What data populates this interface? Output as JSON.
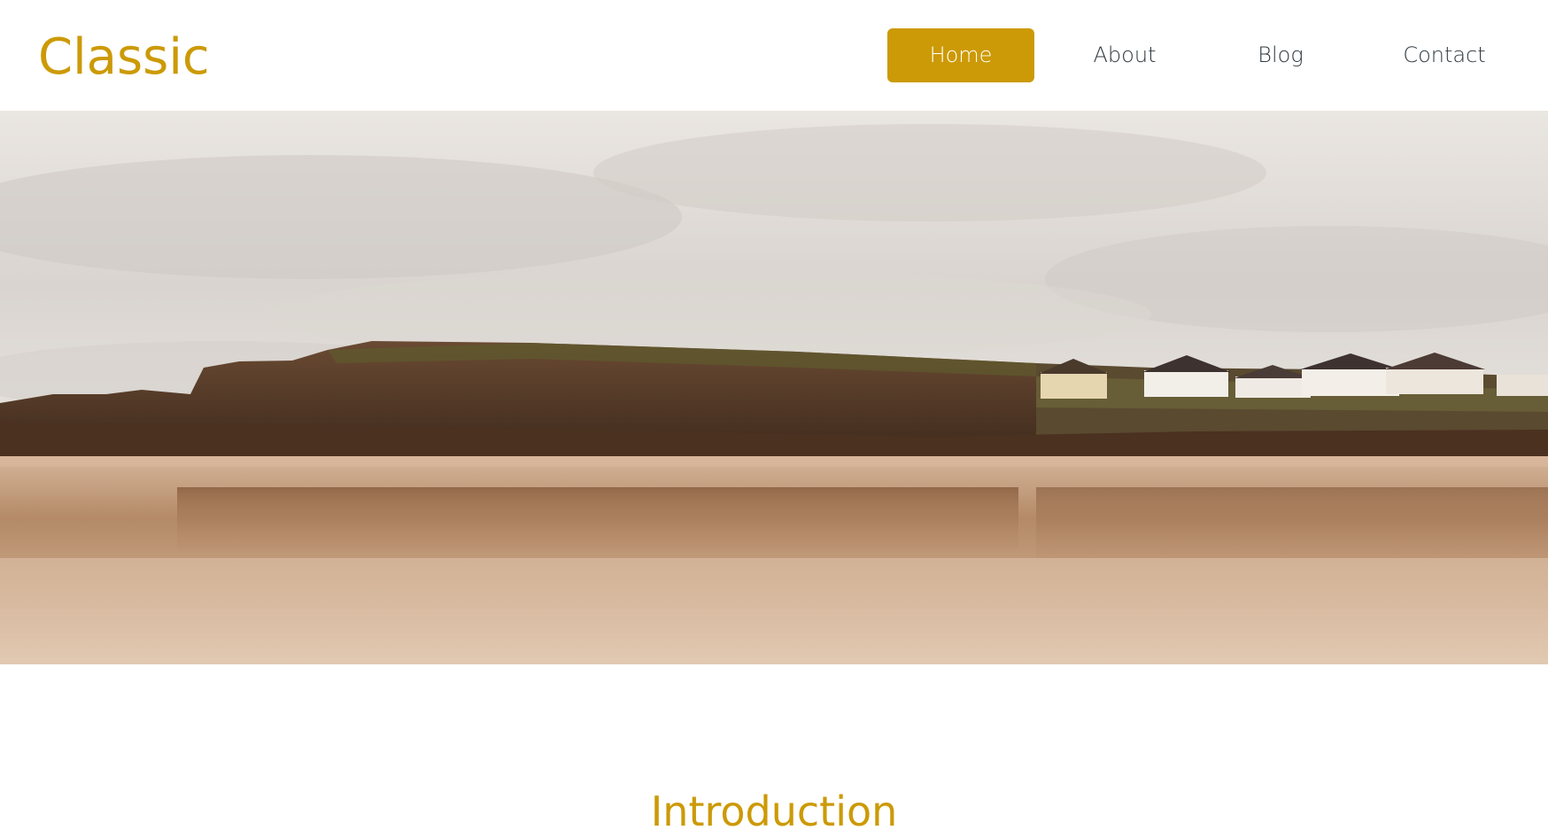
{
  "header": {
    "logo": "Classic"
  },
  "nav": {
    "items": [
      {
        "label": "Home",
        "active": true
      },
      {
        "label": "About",
        "active": false
      },
      {
        "label": "Blog",
        "active": false
      },
      {
        "label": "Contact",
        "active": false
      }
    ]
  },
  "hero": {
    "image": "coastal-cliffs-beach-photo"
  },
  "main": {
    "section_title": "Introduction"
  },
  "colors": {
    "accent": "#cc9a06",
    "nav_text": "#2f3a40",
    "background": "#ffffff"
  }
}
